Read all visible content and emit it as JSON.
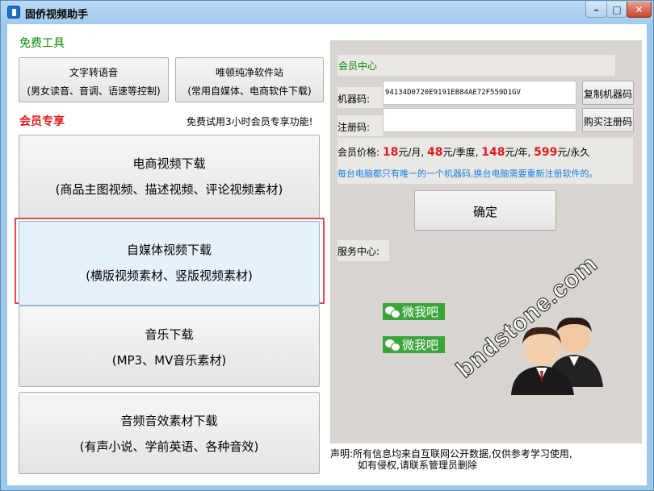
{
  "window": {
    "title": "固侨视频助手",
    "minimize": "–",
    "maximize": "□",
    "close": "✕"
  },
  "left": {
    "free_tools_title": "免费工具",
    "tools": [
      {
        "line1": "文字转语音",
        "line2": "(男女读音、音调、语速等控制)"
      },
      {
        "line1": "唯顿纯净软件站",
        "line2": "(常用自媒体、电商软件下载)"
      }
    ],
    "member_title": "会员专享",
    "trial_text": "免费试用3小时会员专享功能!",
    "features": [
      {
        "line1": "电商视频下载",
        "line2": "(商品主图视频、描述视频、评论视频素材)"
      },
      {
        "line1": "自媒体视频下载",
        "line2": "(横版视频素材、竖版视频素材)"
      },
      {
        "line1": "音乐下载",
        "line2": "(MP3、MV音乐素材)"
      },
      {
        "line1": "音频音效素材下载",
        "line2": "(有声小说、学前英语、各种音效)"
      }
    ]
  },
  "right": {
    "member_center": "会员中心",
    "machine_label": "机器码:",
    "machine_code": "94134D0720E9191EB84AE72F559D1GV",
    "copy_button": "复制机器码",
    "reg_label": "注册码:",
    "reg_value": "",
    "buy_button": "购买注册码",
    "price": {
      "label": "会员价格:",
      "month_num": "18",
      "month_unit": "元/月,",
      "quarter_num": "48",
      "quarter_unit": "元/季度,",
      "year_num": "148",
      "year_unit": "元/年,",
      "forever_num": "599",
      "forever_unit": "元/永久"
    },
    "price_note": "每台电脑都只有唯一的一个机器码,换台电脑需要重新注册软件的。",
    "ok_button": "确定",
    "service_label": "服务中心:",
    "wechat_1": "微我吧",
    "wechat_2": "微我吧",
    "watermark": "bndstone.com"
  },
  "disclaimer": {
    "line1": "声明:所有信息均来自互联网公开数据,仅供参考学习使用,",
    "line2": "如有侵权,请联系管理员删除"
  },
  "colors": {
    "green": "#0a8a0a",
    "red": "#e01c1c",
    "blue_note": "#1683e0",
    "wechat_green": "#3ba53b",
    "highlight_frame": "#e6474f"
  }
}
